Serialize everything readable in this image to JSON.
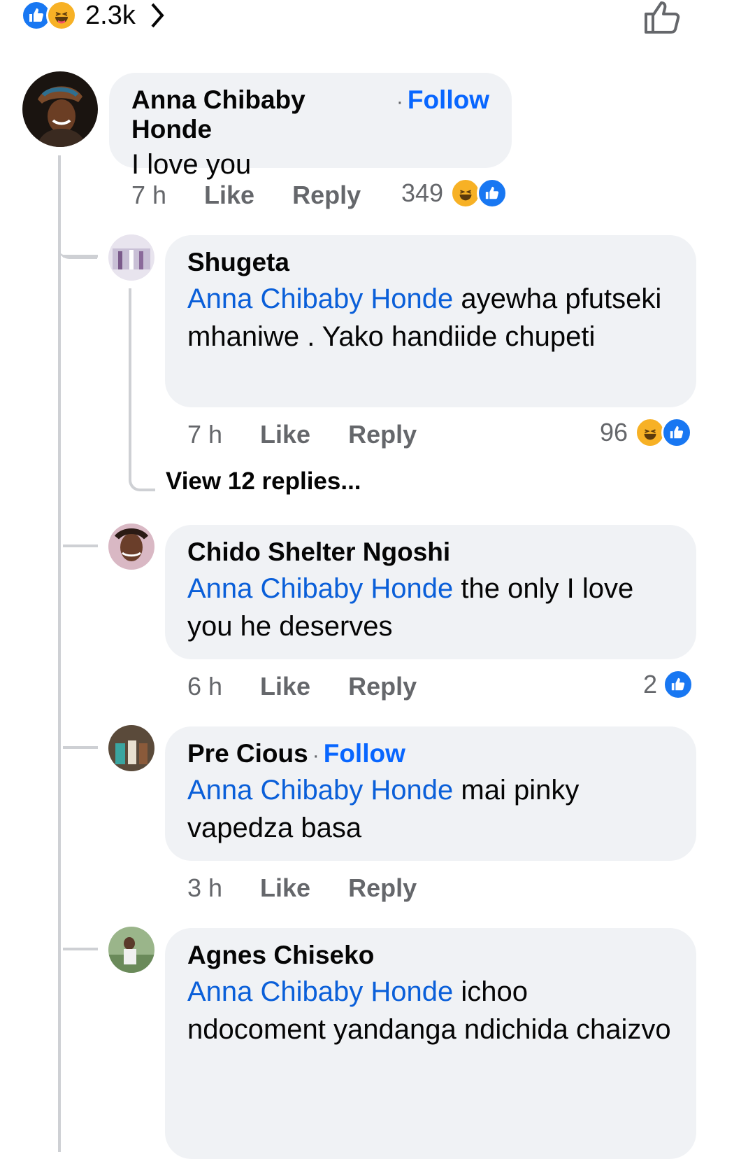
{
  "header": {
    "reaction_count": "2.3k",
    "reaction_icons": [
      "like-icon",
      "haha-icon"
    ],
    "chevron_icon": "chevron-right-icon",
    "like_action_icon": "thumbs-up-outline-icon"
  },
  "colors": {
    "accent": "#0866ff",
    "bubble": "#f0f2f5",
    "meta": "#65676b",
    "thread_line": "#ced0d4"
  },
  "comment": {
    "author": "Anna Chibaby Honde",
    "follow": "Follow",
    "text": "I love you",
    "time": "7 h",
    "like": "Like",
    "reply": "Reply",
    "reaction_count": "349"
  },
  "replies": [
    {
      "author": "Shugeta",
      "mention": "Anna Chibaby Honde",
      "text_line1": "ayewha",
      "text_rest": "pfutseki mhaniwe . Yako handiide chupeti",
      "time": "7 h",
      "like": "Like",
      "reply": "Reply",
      "reaction_count": "96",
      "view_replies": "View 12 replies..."
    },
    {
      "author": "Chido Shelter Ngoshi",
      "mention": "Anna Chibaby Honde",
      "text_line1": "the only I love",
      "text_rest": "you he deserves",
      "time": "6 h",
      "like": "Like",
      "reply": "Reply",
      "reaction_count": "2"
    },
    {
      "author": "Pre Cious",
      "follow": "Follow",
      "mention": "Anna Chibaby Honde",
      "text_line1": "mai pinky",
      "text_rest": "vapedza basa",
      "time": "3 h",
      "like": "Like",
      "reply": "Reply"
    },
    {
      "author": "Agnes Chiseko",
      "mention": "Anna Chibaby Honde",
      "text_line1": "ichoo",
      "text_rest": "ndocoment yandanga ndichida chaizvo"
    }
  ]
}
